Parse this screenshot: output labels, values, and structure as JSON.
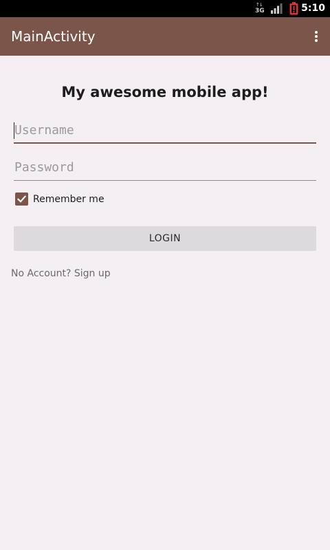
{
  "status_bar": {
    "network_type": "3G",
    "time": "5:10",
    "battery_color": "#e0312f"
  },
  "action_bar": {
    "title": "MainActivity",
    "overflow_icon": "more-vert-icon",
    "background": "#7b5549"
  },
  "login_form": {
    "app_title": "My awesome mobile app!",
    "username_placeholder": "Username",
    "password_placeholder": "Password",
    "remember_label": "Remember me",
    "remember_checked": true,
    "login_button_label": "LOGIN",
    "signup_text": "No Account? Sign up"
  }
}
